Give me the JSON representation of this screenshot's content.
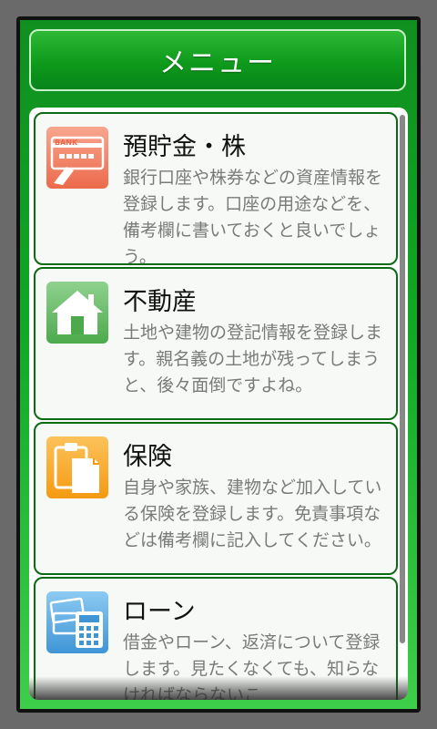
{
  "header": {
    "title": "メニュー"
  },
  "items": [
    {
      "title": "預貯金・株",
      "description": "銀行口座や株券などの資産情報を登録します。口座の用途などを、備考欄に書いておくと良いでしょう。",
      "icon": "bank-card-icon",
      "bank_label": "BANK"
    },
    {
      "title": "不動産",
      "description": "土地や建物の登記情報を登録します。親名義の土地が残ってしまうと、後々面倒ですよね。",
      "icon": "house-icon"
    },
    {
      "title": "保険",
      "description": "自身や家族、建物など加入している保険を登録します。免責事項などは備考欄に記入してください。",
      "icon": "clipboard-icon"
    },
    {
      "title": "ローン",
      "description": "借金やローン、返済について登録します。見たくなくても、知らなければならないこ",
      "icon": "calculator-cards-icon"
    }
  ],
  "colors": {
    "title_bar": "#0e9a1b",
    "card_border": "#0b6b13",
    "savings_icon": "#f07b5c",
    "realestate_icon": "#5cb85c",
    "insurance_icon": "#f5a623",
    "loan_icon": "#4fa6e0"
  }
}
